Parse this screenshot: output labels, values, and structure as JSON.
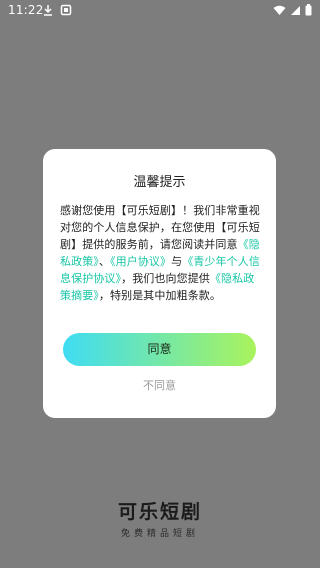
{
  "status_bar": {
    "time": "11:22",
    "left_icons": [
      "download-icon",
      "notification-icon"
    ],
    "right_icons": [
      "wifi-icon",
      "signal-icon",
      "battery-icon"
    ]
  },
  "dialog": {
    "title": "温馨提示",
    "segments": [
      {
        "text": "感谢您使用【可乐短剧】！我们非常重视对您的个人信息保护，在您使用【可乐短剧】提供的服务前，请您阅读并同意",
        "link": false
      },
      {
        "text": "《隐私政策》",
        "link": true
      },
      {
        "text": "、",
        "link": false
      },
      {
        "text": "《用户协议》",
        "link": true
      },
      {
        "text": "与",
        "link": false
      },
      {
        "text": "《青少年个人信息保护协议》",
        "link": true
      },
      {
        "text": "，我们也向您提供",
        "link": false
      },
      {
        "text": "《隐私政策摘要》",
        "link": true
      },
      {
        "text": "，特别是其中加粗条款。",
        "link": false
      }
    ],
    "agree_label": "同意",
    "disagree_label": "不同意",
    "link_color": "#19c6a5"
  },
  "brand": {
    "logo_text": "可乐短剧",
    "slogan": "免费精品短剧"
  }
}
